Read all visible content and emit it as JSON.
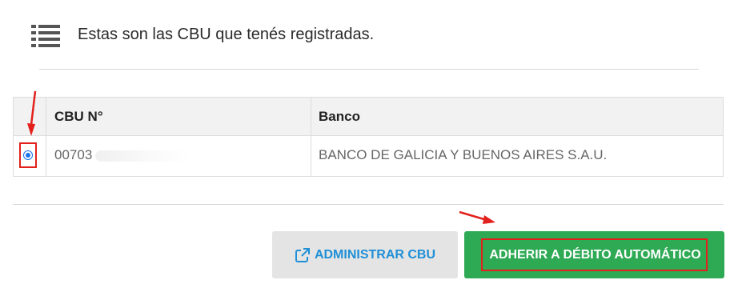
{
  "header": {
    "title": "Estas son las CBU que tenés registradas.",
    "icon": "list-icon"
  },
  "table": {
    "columns": [
      "",
      "CBU N°",
      "Banco"
    ],
    "rows": [
      {
        "selected": true,
        "cbu": "00703",
        "banco": "BANCO DE GALICIA Y BUENOS AIRES S.A.U."
      }
    ]
  },
  "actions": {
    "admin_label": "ADMINISTRAR CBU",
    "adherir_label": "ADHERIR A DÉBITO AUTOMÁTICO"
  },
  "colors": {
    "primary_green": "#2eaa55",
    "link_blue": "#1f8fd6",
    "highlight_red": "#e2211c",
    "secondary_gray": "#e4e4e4"
  }
}
